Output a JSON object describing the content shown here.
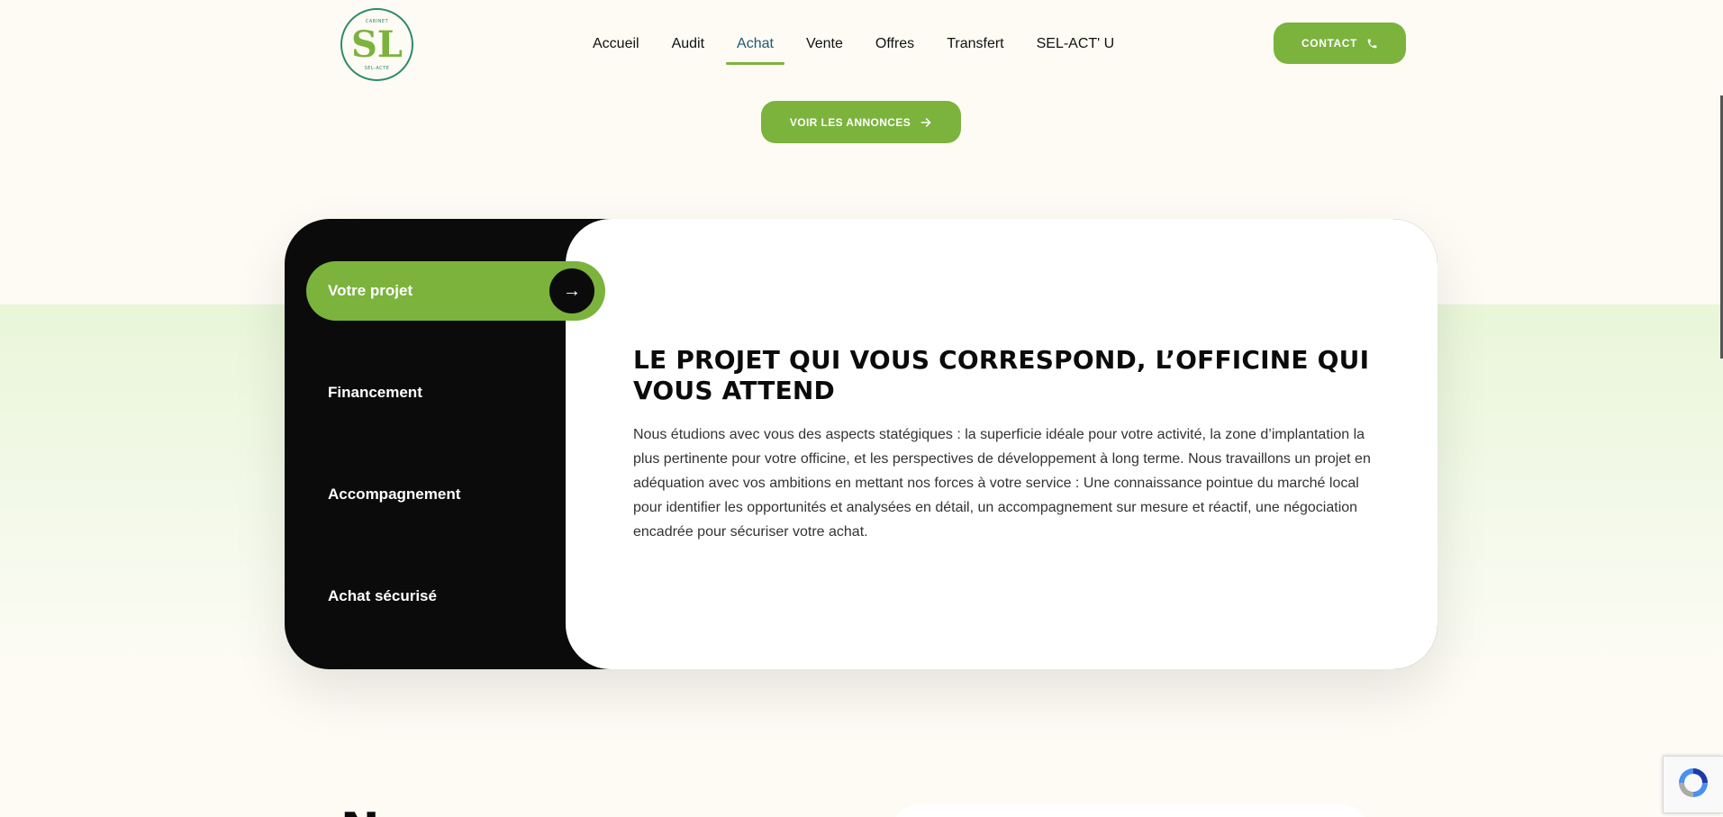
{
  "logo": {
    "top_text": "CABINET",
    "mark": "SL",
    "bottom_text": "SEL-ACTE"
  },
  "nav": {
    "items": [
      {
        "label": "Accueil",
        "active": false
      },
      {
        "label": "Audit",
        "active": false
      },
      {
        "label": "Achat",
        "active": true
      },
      {
        "label": "Vente",
        "active": false
      },
      {
        "label": "Offres",
        "active": false
      },
      {
        "label": "Transfert",
        "active": false
      },
      {
        "label": "SEL-ACT' U",
        "active": false
      }
    ],
    "contact_label": "CONTACT"
  },
  "hero": {
    "announce_label": "VOIR LES ANNONCES"
  },
  "tabs": {
    "items": [
      {
        "label": "Votre projet",
        "active": true
      },
      {
        "label": "Financement",
        "active": false
      },
      {
        "label": "Accompagnement",
        "active": false
      },
      {
        "label": "Achat sécurisé",
        "active": false
      }
    ],
    "arrow_glyph": "→"
  },
  "panel": {
    "title": "LE PROJET QUI VOUS CORRESPOND, L’OFFICINE QUI VOUS ATTEND",
    "text": "Nous étudions avec vous des aspects statégiques : la superficie idéale pour votre activité, la zone d’implantation la plus pertinente pour votre officine, et les perspectives de développement à long terme. Nous travaillons un projet en adéquation avec vos ambitions en mettant nos forces à votre service : Une connaissance pointue du marché local pour identifier les opportunités et analysées en détail, un accompagnement sur mesure et réactif, une négociation encadrée pour sécuriser votre achat."
  },
  "next_section": {
    "heading_partial": "Nos annonces"
  },
  "colors": {
    "accent": "#7bb33d",
    "dark": "#0b0b0b",
    "page_bg": "#fdfbf4",
    "band": "#e9f6d8",
    "nav_active": "#1a5a78"
  }
}
